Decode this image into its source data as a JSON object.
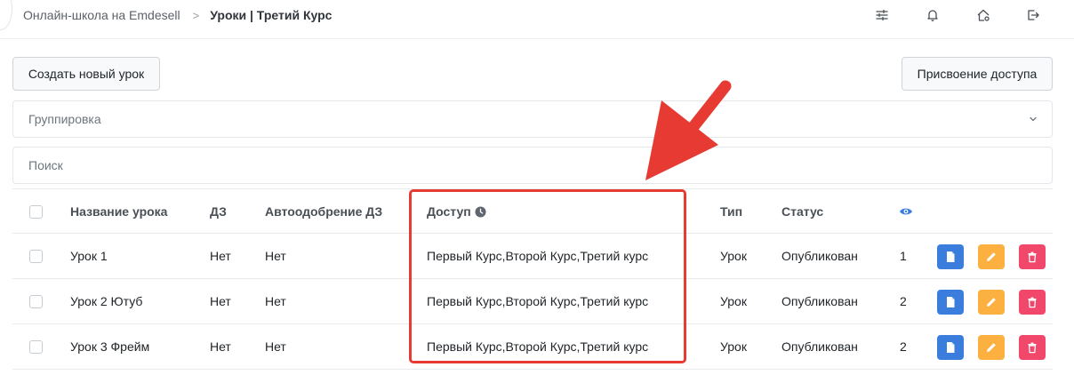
{
  "header": {
    "breadcrumb": [
      {
        "label": "Онлайн-школа на Emdesell"
      },
      {
        "label": "Уроки | Третий Курс"
      }
    ],
    "breadcrumb_separator": ">",
    "icons": [
      "sliders-icon",
      "bell-icon",
      "home-settings-icon",
      "logout-icon"
    ]
  },
  "toolbar": {
    "create_label": "Создать новый урок",
    "access_label": "Присвоение доступа"
  },
  "grouping": {
    "label": "Группировка"
  },
  "search": {
    "placeholder": "Поиск",
    "value": ""
  },
  "table": {
    "columns": {
      "name": "Название урока",
      "hw": "ДЗ",
      "auto": "Автоодобрение ДЗ",
      "access": "Доступ",
      "type": "Тип",
      "status": "Статус",
      "views": "eye-icon"
    },
    "rows": [
      {
        "name": "Урок 1",
        "hw": "Нет",
        "auto": "Нет",
        "access": "Первый Курс,Второй Курс,Третий курс",
        "type": "Урок",
        "status": "Опубликован",
        "views": "1"
      },
      {
        "name": "Урок 2 Ютуб",
        "hw": "Нет",
        "auto": "Нет",
        "access": "Первый Курс,Второй Курс,Третий курс",
        "type": "Урок",
        "status": "Опубликован",
        "views": "2"
      },
      {
        "name": "Урок 3 Фрейм",
        "hw": "Нет",
        "auto": "Нет",
        "access": "Первый Курс,Второй Курс,Третий курс",
        "type": "Урок",
        "status": "Опубликован",
        "views": "2"
      }
    ]
  },
  "colors": {
    "doc_button": "#3b7ddd",
    "edit_button": "#fcb040",
    "delete_button": "#f0476b",
    "annotation": "#e63a32",
    "eye_icon": "#3b7ddd"
  }
}
